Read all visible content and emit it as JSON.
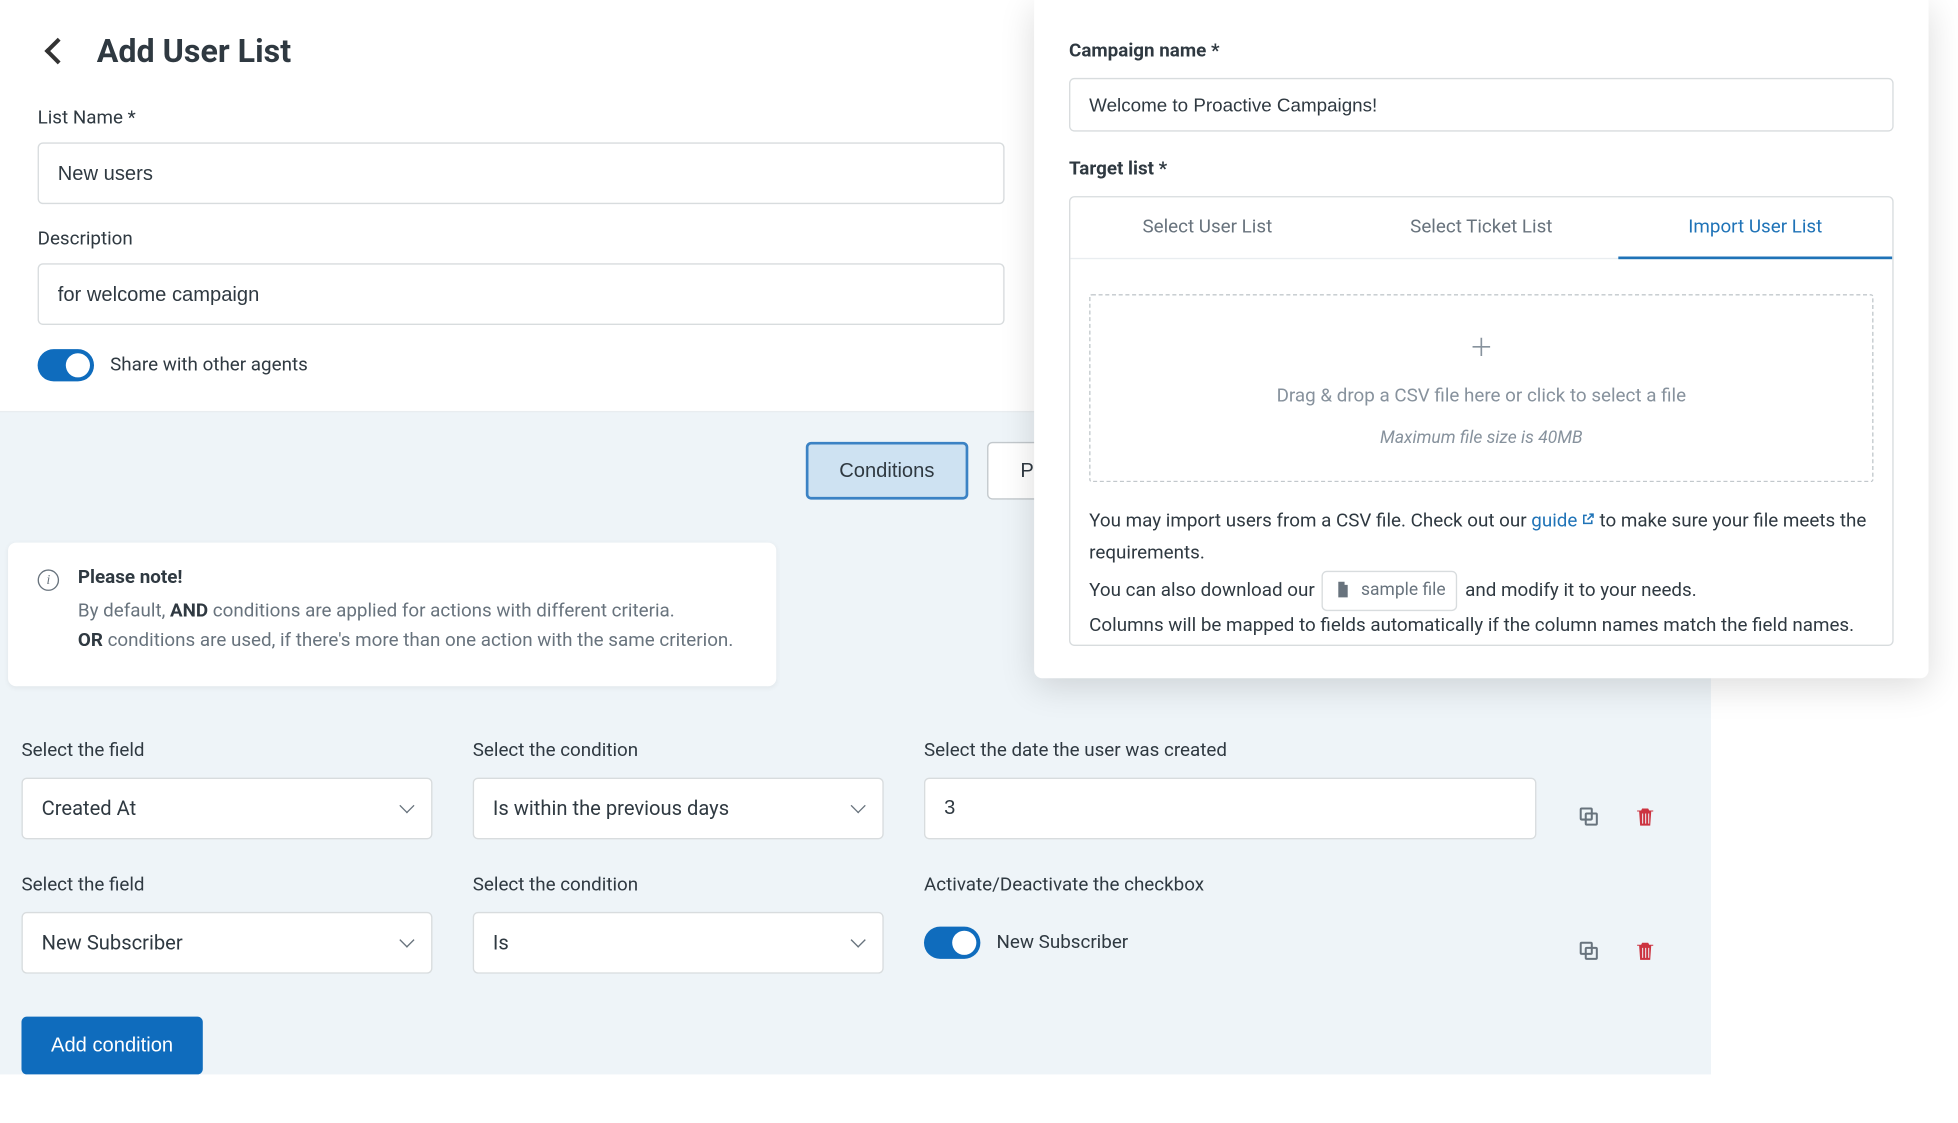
{
  "page": {
    "title": "Add User List",
    "list_name_label": "List Name *",
    "list_name_value": "New users",
    "description_label": "Description",
    "description_value": "for welcome campaign",
    "share_label": "Share with other agents"
  },
  "tabs": {
    "conditions": "Conditions",
    "preview": "Preview"
  },
  "note": {
    "heading": "Please note!",
    "line1_pre": "By default, ",
    "line1_bold": "AND",
    "line1_post": " conditions are applied for actions with different criteria.",
    "line2_bold": "OR",
    "line2_post": " conditions are used, if there's more than one action with the same criterion."
  },
  "conditions": {
    "field_label": "Select the field",
    "cond_label": "Select the condition",
    "row1": {
      "value_label": "Select the date the user was created",
      "field": "Created At",
      "condition": "Is within the previous days",
      "value": "3"
    },
    "row2": {
      "value_label": "Activate/Deactivate the checkbox",
      "field": "New Subscriber",
      "condition": "Is",
      "checkbox_label": "New Subscriber"
    },
    "add_btn": "Add condition"
  },
  "side": {
    "campaign_label": "Campaign name *",
    "campaign_value": "Welcome to Proactive Campaigns!",
    "target_label": "Target list *",
    "tabs": [
      "Select User List",
      "Select Ticket List",
      "Import User List"
    ],
    "dropzone_main": "Drag & drop a CSV file here or click to select a file",
    "dropzone_sub": "Maximum file size is 40MB",
    "help1_pre": "You may import users from a CSV file. Check out our ",
    "help1_link": "guide",
    "help1_post": " to make sure your file meets the requirements.",
    "help2_pre": "You can also download our ",
    "help2_btn": "sample file",
    "help2_post": " and modify it to your needs.",
    "help3": "Columns will be mapped to fields automatically if the column names match the field names."
  }
}
